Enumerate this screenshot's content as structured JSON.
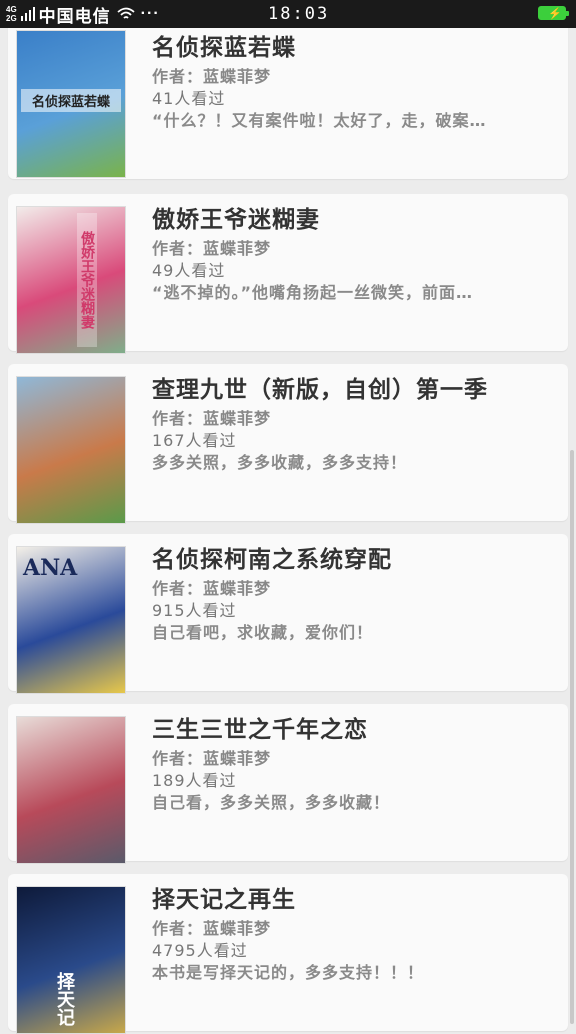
{
  "status_bar": {
    "network_top": "4G",
    "network_bottom": "2G",
    "carrier": "中国电信",
    "more": "···",
    "time": "18:03"
  },
  "books": [
    {
      "title": "名侦探蓝若蝶",
      "author": "作者：蓝蝶菲梦",
      "views": "41人看过",
      "desc": "“什么？！又有案件啦！太好了，走，破案…",
      "cover_text": "名侦探蓝若蝶",
      "cover_colors": [
        "#3a7fc8",
        "#5aa0d8",
        "#7ab34a"
      ]
    },
    {
      "title": "傲娇王爷迷糊妻",
      "author": "作者：蓝蝶菲梦",
      "views": "49人看过",
      "desc": "“逃不掉的。”他嘴角扬起一丝微笑，前面…",
      "cover_text": "傲娇王爷迷糊妻",
      "cover_colors": [
        "#f2ecea",
        "#d94a7a",
        "#7fae8a"
      ]
    },
    {
      "title": "查理九世（新版，自创）第一季",
      "author": "作者：蓝蝶菲梦",
      "views": "167人看过",
      "desc": "多多关照，多多收藏，多多支持！",
      "cover_text": "",
      "cover_colors": [
        "#8fb8d8",
        "#c97a4a",
        "#5a9a4a"
      ]
    },
    {
      "title": "名侦探柯南之系统穿配",
      "author": "作者：蓝蝶菲梦",
      "views": "915人看过",
      "desc": "自己看吧，求收藏，爱你们！",
      "cover_text": "ANA",
      "cover_colors": [
        "#f4f0e8",
        "#2a4a9a",
        "#e8c84a"
      ]
    },
    {
      "title": "三生三世之千年之恋",
      "author": "作者：蓝蝶菲梦",
      "views": "189人看过",
      "desc": "自己看，多多关照，多多收藏！",
      "cover_text": "",
      "cover_colors": [
        "#e8dcd8",
        "#b84a5a",
        "#5a5a6a"
      ]
    },
    {
      "title": "择天记之再生",
      "author": "作者：蓝蝶菲梦",
      "views": "4795人看过",
      "desc": "本书是写择天记的，多多支持！！！",
      "cover_text": "择天记",
      "cover_colors": [
        "#0e1a3a",
        "#2a4a8a",
        "#c8a84a"
      ]
    }
  ]
}
